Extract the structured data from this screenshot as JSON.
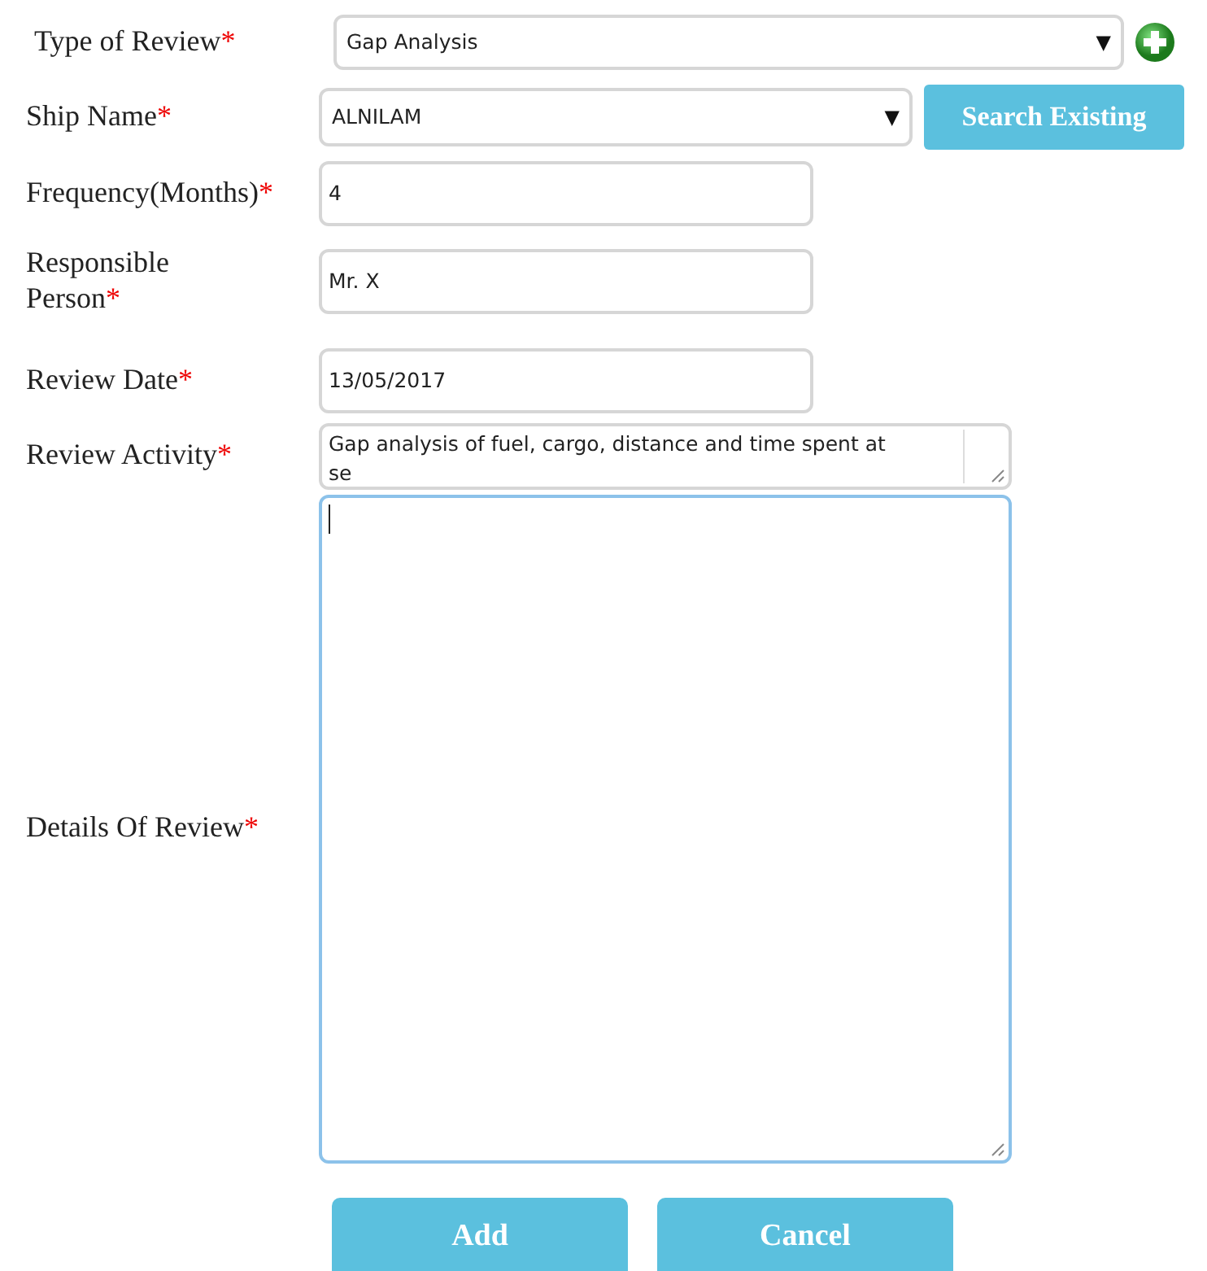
{
  "fields": [
    {
      "kind": "select",
      "label": "Type of Review",
      "required_mark": "*",
      "value": "Gap Analysis",
      "caret": "▼",
      "side": {
        "kind": "add-icon"
      }
    },
    {
      "kind": "select",
      "label": "Ship Name",
      "required_mark": "*",
      "value": "ALNILAM",
      "caret": "▼",
      "side": {
        "kind": "button",
        "label": "Search Existing"
      }
    },
    {
      "kind": "input",
      "label": "Frequency(Months)",
      "required_mark": "*",
      "value": "4"
    },
    {
      "kind": "input",
      "label": "Responsible Person",
      "required_mark": "*",
      "value": "Mr. X"
    },
    {
      "kind": "input",
      "label": "Review Date",
      "required_mark": "*",
      "value": "13/05/2017"
    },
    {
      "kind": "textarea",
      "label": "Review Activity",
      "required_mark": "*",
      "value": "Gap analysis of fuel, cargo, distance and time spent at se",
      "focused": false
    },
    {
      "kind": "textarea",
      "label": "Details Of Review",
      "required_mark": "*",
      "focused": true
    }
  ],
  "buttons": [
    {
      "label": "Add"
    },
    {
      "label": "Cancel"
    }
  ]
}
